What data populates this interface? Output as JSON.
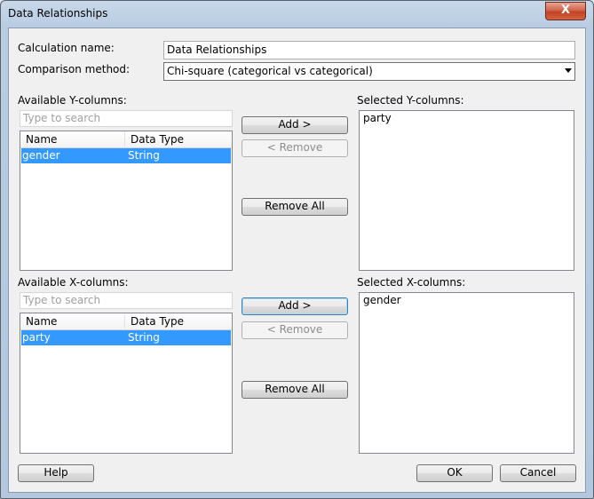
{
  "window": {
    "title": "Data Relationships",
    "close_glyph": "X"
  },
  "form": {
    "calc_name_label": "Calculation name:",
    "calc_name_value": "Data Relationships",
    "comparison_label": "Comparison method:",
    "comparison_value": "Chi-square (categorical vs categorical)"
  },
  "y_section": {
    "available_label": "Available Y-columns:",
    "search_placeholder": "Type to search",
    "col_name": "Name",
    "col_type": "Data Type",
    "rows": [
      {
        "name": "gender",
        "type": "String"
      }
    ],
    "add_label": "Add >",
    "remove_label": "< Remove",
    "remove_all_label": "Remove All",
    "selected_label": "Selected Y-columns:",
    "selected_items": [
      "party"
    ]
  },
  "x_section": {
    "available_label": "Available X-columns:",
    "search_placeholder": "Type to search",
    "col_name": "Name",
    "col_type": "Data Type",
    "rows": [
      {
        "name": "party",
        "type": "String"
      }
    ],
    "add_label": "Add >",
    "remove_label": "< Remove",
    "remove_all_label": "Remove All",
    "selected_label": "Selected X-columns:",
    "selected_items": [
      "gender"
    ]
  },
  "footer": {
    "help_label": "Help",
    "ok_label": "OK",
    "cancel_label": "Cancel"
  }
}
